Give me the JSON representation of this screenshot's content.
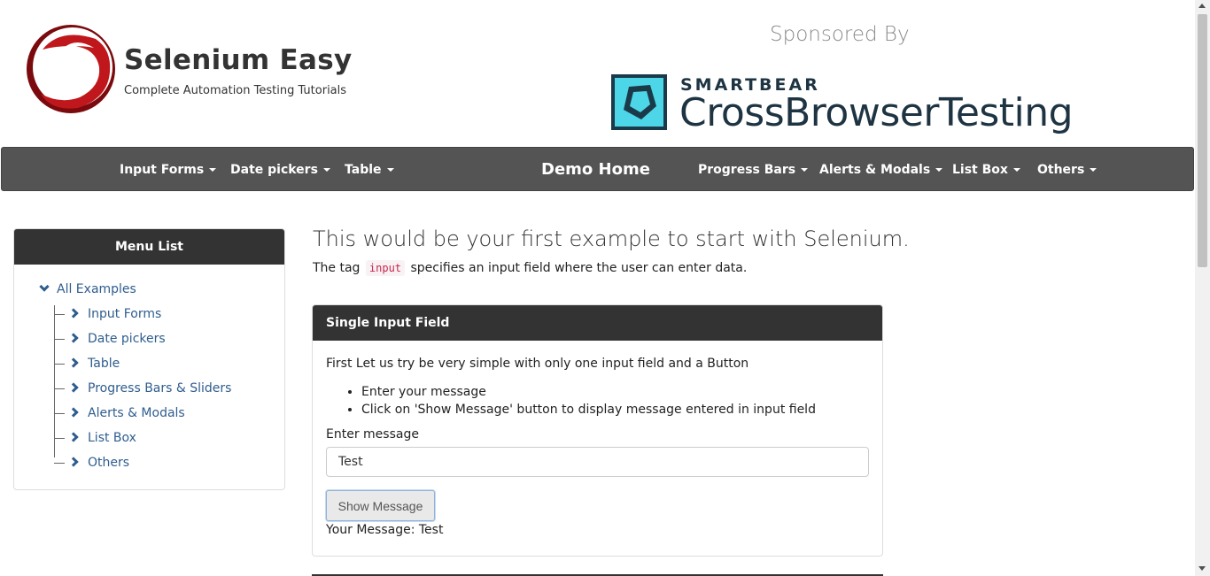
{
  "header": {
    "brand_title": "Selenium Easy",
    "brand_subtitle": "Complete Automation Testing Tutorials",
    "logo_icon": "selenium-easy-logo",
    "sponsor_label": "Sponsored By",
    "sponsor_company": "SMARTBEAR",
    "sponsor_product": "CrossBrowserTesting"
  },
  "nav": {
    "items": [
      {
        "label": "Input Forms"
      },
      {
        "label": "Date pickers"
      },
      {
        "label": "Table"
      },
      {
        "label": "Demo Home"
      },
      {
        "label": "Progress Bars"
      },
      {
        "label": "Alerts & Modals"
      },
      {
        "label": "List Box"
      },
      {
        "label": "Others"
      }
    ]
  },
  "sidebar": {
    "title": "Menu List",
    "root": "All Examples",
    "items": [
      {
        "label": "Input Forms"
      },
      {
        "label": "Date pickers"
      },
      {
        "label": "Table"
      },
      {
        "label": "Progress Bars & Sliders"
      },
      {
        "label": "Alerts & Modals"
      },
      {
        "label": "List Box"
      },
      {
        "label": "Others"
      }
    ]
  },
  "main": {
    "title": "This would be your first example to start with Selenium.",
    "desc_before": "The tag",
    "desc_code": "input",
    "desc_after": "specifies an input field where the user can enter data.",
    "panel": {
      "title": "Single Input Field",
      "intro": "First Let us try be very simple with only one input field and a Button",
      "bullets": [
        "Enter your message",
        "Click on 'Show Message' button to display message entered in input field"
      ],
      "field_label": "Enter message",
      "field_value": "Test",
      "button_label": "Show Message",
      "result_label": "Your Message:",
      "result_value": "Test"
    }
  },
  "colors": {
    "nav_bg": "#545454",
    "panel_head_bg": "#333333",
    "link": "#2f5d8e",
    "logo_red": "#c0171c",
    "sponsor_cyan": "#4dd6e8"
  }
}
